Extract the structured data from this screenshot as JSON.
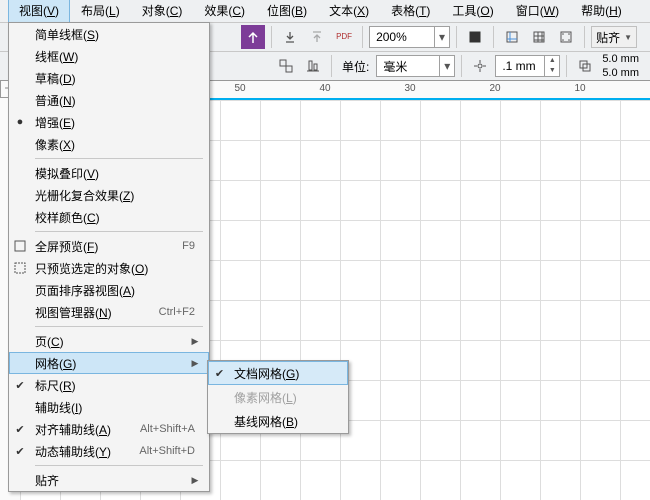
{
  "menubar": {
    "items": [
      {
        "label": "视图",
        "key": "V",
        "active": true
      },
      {
        "label": "布局",
        "key": "L"
      },
      {
        "label": "对象",
        "key": "C"
      },
      {
        "label": "效果",
        "key": "C"
      },
      {
        "label": "位图",
        "key": "B"
      },
      {
        "label": "文本",
        "key": "X"
      },
      {
        "label": "表格",
        "key": "T"
      },
      {
        "label": "工具",
        "key": "O"
      },
      {
        "label": "窗口",
        "key": "W"
      },
      {
        "label": "帮助",
        "key": "H"
      }
    ]
  },
  "toolbar1": {
    "zoom_value": "200%",
    "snap_label": "贴齐"
  },
  "toolbar2": {
    "unit_label": "单位:",
    "unit_value": "毫米",
    "nudge_value": ".1 mm",
    "width_value": "5.0 mm",
    "height_value": "5.0 mm"
  },
  "ruler_h": {
    "ticks": [
      "50",
      "40",
      "30",
      "20",
      "10"
    ]
  },
  "view_menu": {
    "items": [
      {
        "label": "简单线框",
        "key": "S"
      },
      {
        "label": "线框",
        "key": "W"
      },
      {
        "label": "草稿",
        "key": "D"
      },
      {
        "label": "普通",
        "key": "N"
      },
      {
        "label": "增强",
        "key": "E",
        "checked": "dot"
      },
      {
        "label": "像素",
        "key": "X"
      },
      {
        "sep": true
      },
      {
        "label": "模拟叠印",
        "key": "V"
      },
      {
        "label": "光栅化复合效果",
        "key": "Z"
      },
      {
        "label": "校样颜色",
        "key": "C"
      },
      {
        "sep": true
      },
      {
        "label": "全屏预览",
        "key": "F",
        "icon": "fullscreen",
        "shortcut": "F9"
      },
      {
        "label": "只预览选定的对象",
        "key": "O",
        "icon": "select-preview"
      },
      {
        "label": "页面排序器视图",
        "key": "A"
      },
      {
        "label": "视图管理器",
        "key": "N",
        "shortcut": "Ctrl+F2"
      },
      {
        "sep": true
      },
      {
        "label": "页",
        "key": "C",
        "arrow": true
      },
      {
        "label": "网格",
        "key": "G",
        "arrow": true,
        "hover": true
      },
      {
        "label": "标尺",
        "key": "R",
        "checked": "check"
      },
      {
        "label": "辅助线",
        "key": "I"
      },
      {
        "label": "对齐辅助线",
        "key": "A",
        "checked": "check",
        "shortcut": "Alt+Shift+A"
      },
      {
        "label": "动态辅助线",
        "key": "Y",
        "checked": "check",
        "shortcut": "Alt+Shift+D"
      },
      {
        "sep": true
      },
      {
        "label": "贴齐",
        "key": "",
        "arrow": true
      }
    ]
  },
  "grid_submenu": {
    "items": [
      {
        "label": "文档网格",
        "key": "G",
        "checked": "check",
        "hover": true
      },
      {
        "label": "像素网格",
        "key": "L",
        "disabled": true
      },
      {
        "label": "基线网格",
        "key": "B"
      }
    ]
  }
}
